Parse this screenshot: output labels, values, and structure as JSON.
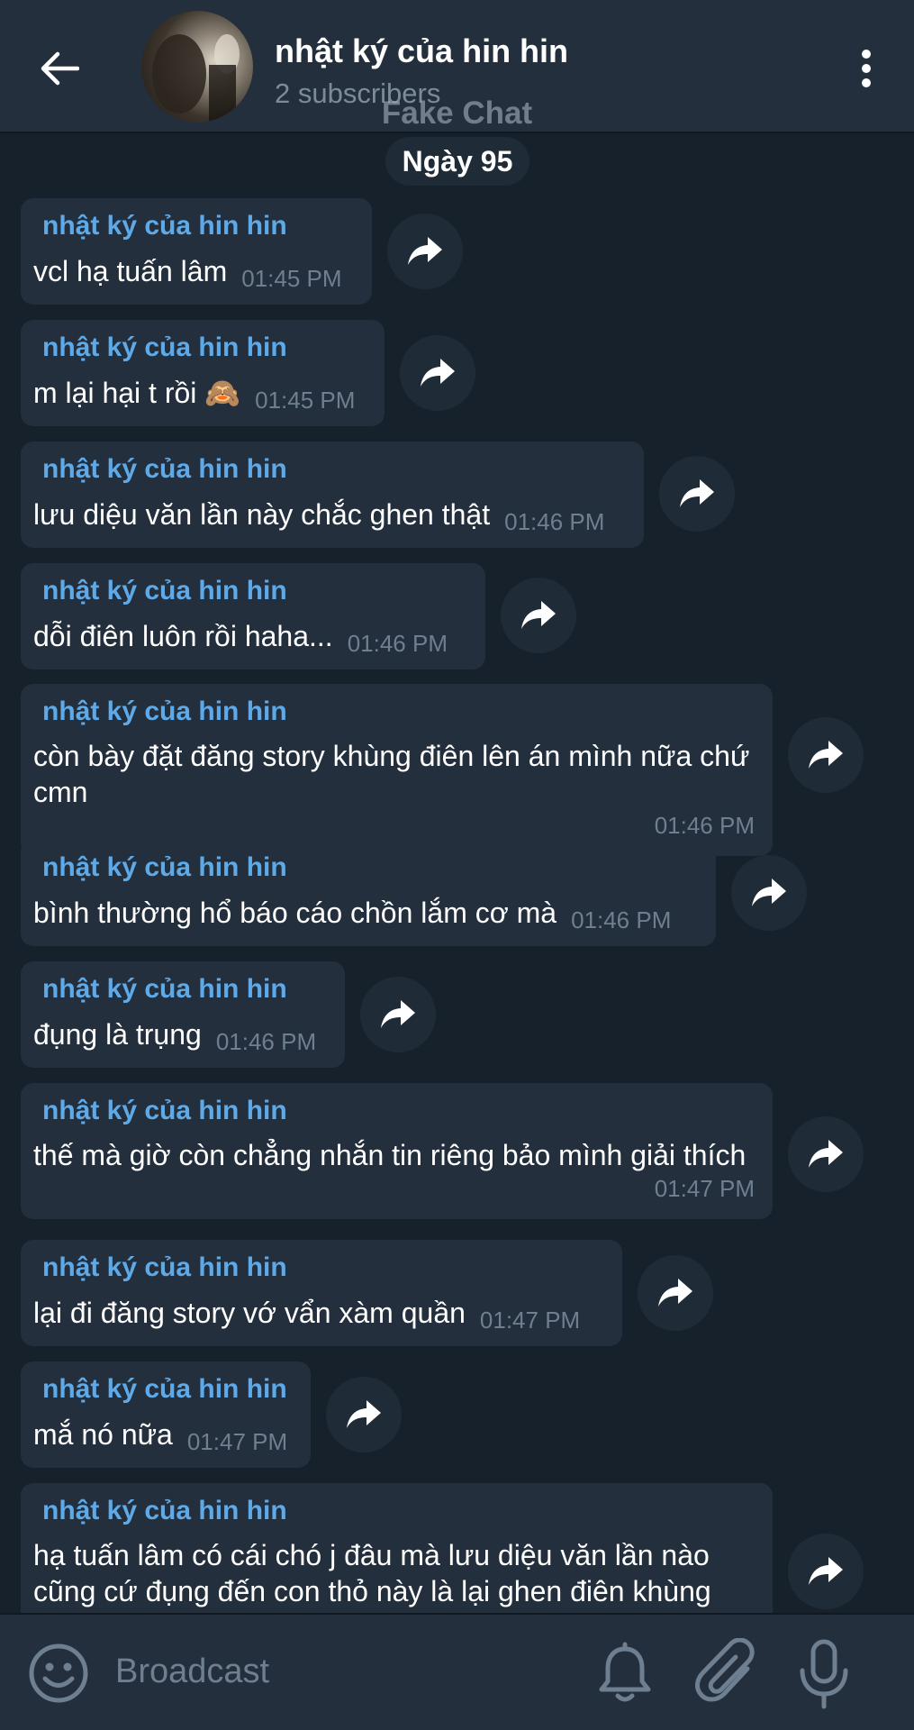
{
  "header": {
    "back_icon": "arrow-left-icon",
    "title": "nhật ký của hin hin",
    "subtitle": "2 subscribers",
    "watermark": "Fake Chat",
    "menu_icon": "more-vertical-icon"
  },
  "date_label": "Ngày 95",
  "messages": [
    {
      "sender": "nhật ký của hin hin",
      "text": "vcl hạ tuấn lâm",
      "time": "01:45 PM"
    },
    {
      "sender": "nhật ký của hin hin",
      "text": "m lại hại t rồi 🙈",
      "time": "01:45 PM"
    },
    {
      "sender": "nhật ký của hin hin",
      "text": "lưu diệu văn lần này chắc ghen thật",
      "time": "01:46 PM"
    },
    {
      "sender": "nhật ký của hin hin",
      "text": "dỗi điên luôn rồi haha...",
      "time": "01:46 PM"
    },
    {
      "sender": "nhật ký của hin hin",
      "text": "còn bày đặt đăng story khùng điên lên án mình nữa chứ cmn",
      "time": "01:46 PM"
    },
    {
      "sender": "nhật ký của hin hin",
      "text": "bình thường hổ báo cáo chồn lắm cơ mà",
      "time": "01:46 PM"
    },
    {
      "sender": "nhật ký của hin hin",
      "text": "đụng là trụng",
      "time": "01:46 PM"
    },
    {
      "sender": "nhật ký của hin hin",
      "text": "thế mà giờ còn chẳng nhắn tin riêng bảo mình giải thích",
      "time": "01:47 PM"
    },
    {
      "sender": "nhật ký của hin hin",
      "text": "lại đi đăng story vớ vẩn xàm quần",
      "time": "01:47 PM"
    },
    {
      "sender": "nhật ký của hin hin",
      "text": "mắ nó nữa",
      "time": "01:47 PM"
    },
    {
      "sender": "nhật ký của hin hin",
      "text": "hạ tuấn lâm có cái chó j đâu mà lưu diệu văn lần nào cũng cứ đụng đến con thỏ này là lại ghen điên khùng",
      "time": ""
    }
  ],
  "forward_icon": "share-forward-icon",
  "composer": {
    "placeholder": "Broadcast",
    "emoji_icon": "emoji-smile-icon",
    "bell_icon": "bell-icon",
    "attach_icon": "paperclip-icon",
    "mic_icon": "microphone-icon"
  },
  "colors": {
    "background": "#17212b",
    "bubble": "#242f3d",
    "sender_name": "#5eaae9",
    "time": "#6d7f90",
    "bar": "#242f3d"
  }
}
